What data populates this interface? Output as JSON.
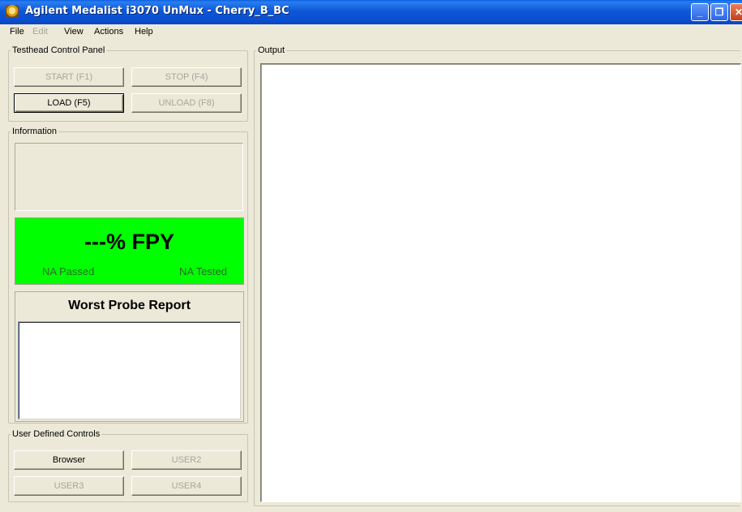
{
  "window": {
    "title": "Agilent Medalist i3070 UnMux - Cherry_B_BC",
    "minimize_glyph": "_",
    "maximize_glyph": "❐",
    "close_glyph": "✕"
  },
  "menu": [
    {
      "label": "File",
      "enabled": true
    },
    {
      "label": "Edit",
      "enabled": false
    },
    {
      "label": "View",
      "enabled": true
    },
    {
      "label": "Actions",
      "enabled": true
    },
    {
      "label": "Help",
      "enabled": true
    }
  ],
  "testhead": {
    "label": "Testhead Control Panel",
    "start": "START (F1)",
    "stop": "STOP (F4)",
    "load": "LOAD (F5)",
    "unload": "UNLOAD (F8)"
  },
  "information": {
    "label": "Information",
    "fpy": "---% FPY",
    "passed": "NA Passed",
    "tested": "NA Tested",
    "fpy_color": "#00ff00",
    "worst_probe_title": "Worst Probe Report"
  },
  "user_controls": {
    "label": "User Defined Controls",
    "browser": "Browser",
    "user2": "USER2",
    "user3": "USER3",
    "user4": "USER4"
  },
  "output": {
    "label": "Output"
  },
  "colors": {
    "titlebar": "#0a4fd0",
    "window_bg": "#ece9d8",
    "disabled_text": "#a7a69b"
  }
}
